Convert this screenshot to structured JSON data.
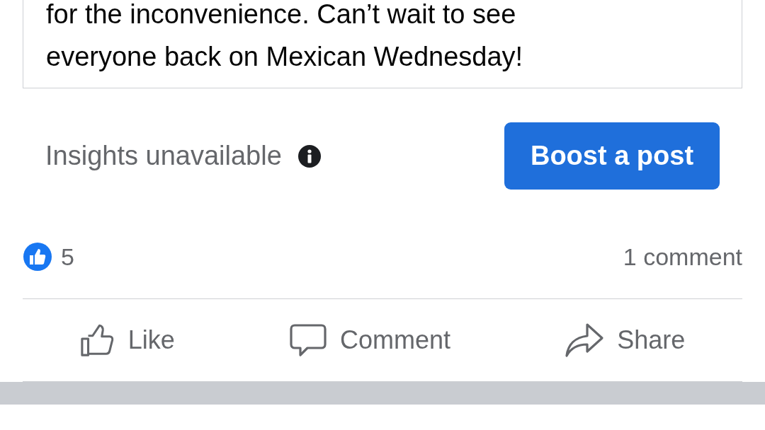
{
  "post": {
    "text": "for the inconvenience. Can’t wait to see everyone back on Mexican Wednesday!"
  },
  "insights": {
    "label": "Insights unavailable"
  },
  "boost_button": {
    "label": "Boost a post"
  },
  "reactions": {
    "count": "5",
    "comments": "1 comment"
  },
  "actions": [
    {
      "kind": "like",
      "label": "Like"
    },
    {
      "kind": "comment",
      "label": "Comment"
    },
    {
      "kind": "share",
      "label": "Share"
    }
  ]
}
